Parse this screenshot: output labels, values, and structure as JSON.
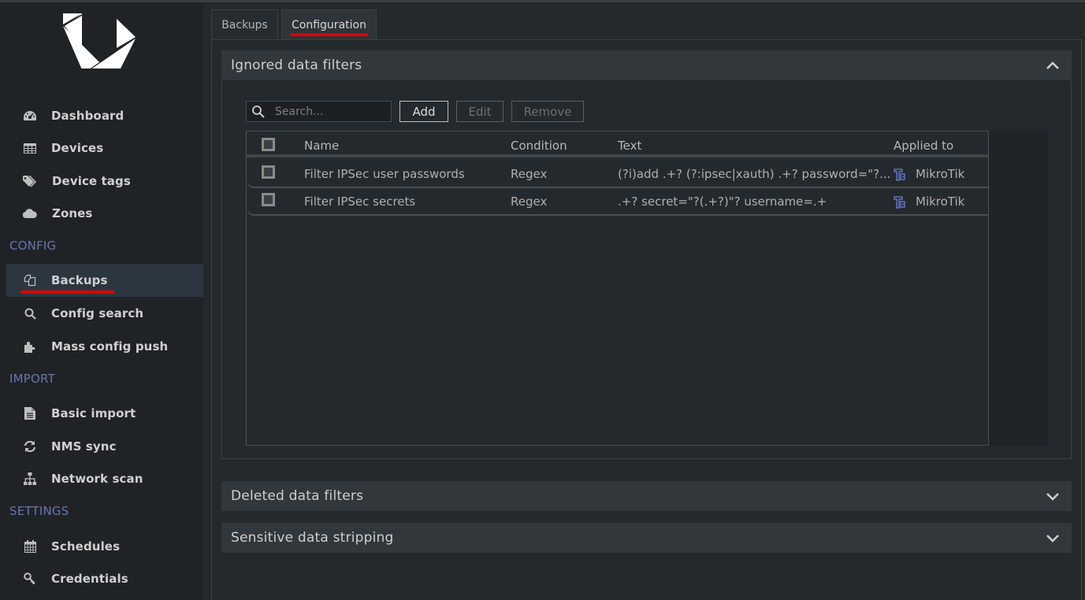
{
  "sidebar": {
    "logo": "app-logo",
    "items_top": [
      {
        "label": "Dashboard",
        "icon": "dashboard-icon"
      },
      {
        "label": "Devices",
        "icon": "table-icon"
      },
      {
        "label": "Device tags",
        "icon": "tags-icon"
      },
      {
        "label": "Zones",
        "icon": "cloud-icon"
      }
    ],
    "sections": [
      {
        "title": "CONFIG",
        "items": [
          {
            "label": "Backups",
            "icon": "copy-icon",
            "active": true
          },
          {
            "label": "Config search",
            "icon": "search-icon"
          },
          {
            "label": "Mass config push",
            "icon": "puzzle-icon"
          }
        ]
      },
      {
        "title": "IMPORT",
        "items": [
          {
            "label": "Basic import",
            "icon": "file-icon"
          },
          {
            "label": "NMS sync",
            "icon": "refresh-icon"
          },
          {
            "label": "Network scan",
            "icon": "sitemap-icon"
          }
        ]
      },
      {
        "title": "SETTINGS",
        "items": [
          {
            "label": "Schedules",
            "icon": "calendar-icon"
          },
          {
            "label": "Credentials",
            "icon": "key-icon"
          }
        ]
      }
    ]
  },
  "tabs": [
    {
      "label": "Backups",
      "active": false
    },
    {
      "label": "Configuration",
      "active": true
    }
  ],
  "accordions": [
    {
      "title": "Ignored data filters",
      "expanded": true
    },
    {
      "title": "Deleted data filters",
      "expanded": false
    },
    {
      "title": "Sensitive data stripping",
      "expanded": false
    }
  ],
  "toolbar": {
    "search_placeholder": "Search...",
    "search_value": "",
    "add_label": "Add",
    "edit_label": "Edit",
    "remove_label": "Remove"
  },
  "grid": {
    "columns": [
      "Name",
      "Condition",
      "Text",
      "Applied to"
    ],
    "rows": [
      {
        "name": "Filter IPSec user passwords",
        "condition": "Regex",
        "text": "(?i)add .+? (?:ipsec|xauth) .+? password=\"?...",
        "applied_to": "MikroTik",
        "applied_icon": "mikrotik-icon"
      },
      {
        "name": "Filter IPSec secrets",
        "condition": "Regex",
        "text": ".+? secret=\"?(.+?)\"? username=.+",
        "applied_to": "MikroTik",
        "applied_icon": "mikrotik-icon"
      }
    ]
  },
  "colors": {
    "accent_underline": "#e00000",
    "section_label": "#6a74b0",
    "vendor_icon": "#6d7fe0"
  }
}
